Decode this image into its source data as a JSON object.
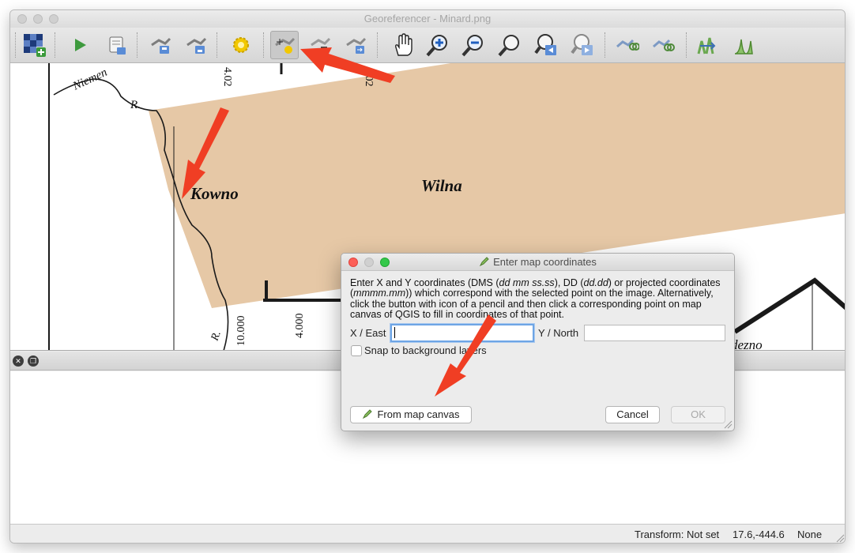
{
  "window": {
    "title": "Georeferencer - Minard.png"
  },
  "toolbar": {
    "buttons": [
      {
        "name": "open-raster",
        "icon": "add-raster-icon"
      },
      {
        "name": "start-georeferencing",
        "icon": "play-icon"
      },
      {
        "name": "generate-gdal-script",
        "icon": "script-icon"
      },
      {
        "name": "load-gcp-points",
        "icon": "load-gcp-icon"
      },
      {
        "name": "save-gcp-points",
        "icon": "save-gcp-icon"
      },
      {
        "name": "transformation-settings",
        "icon": "gear-icon"
      },
      {
        "name": "add-point",
        "icon": "add-point-icon"
      },
      {
        "name": "delete-point",
        "icon": "delete-point-icon"
      },
      {
        "name": "move-gcp-point",
        "icon": "move-point-icon"
      },
      {
        "name": "pan",
        "icon": "hand-icon"
      },
      {
        "name": "zoom-in",
        "icon": "zoom-in-icon"
      },
      {
        "name": "zoom-out",
        "icon": "zoom-out-icon"
      },
      {
        "name": "zoom-to-layer",
        "icon": "zoom-to-layer-icon"
      },
      {
        "name": "zoom-last",
        "icon": "zoom-last-icon"
      },
      {
        "name": "zoom-next",
        "icon": "zoom-next-icon"
      },
      {
        "name": "link-georeferencer-to-qgis",
        "icon": "link-georef-icon"
      },
      {
        "name": "link-qgis-to-georeferencer",
        "icon": "link-qgis-icon"
      },
      {
        "name": "full-histogram-stretch",
        "icon": "histogram-icon"
      },
      {
        "name": "local-histogram-stretch",
        "icon": "local-histogram-icon"
      }
    ]
  },
  "map": {
    "labels": {
      "niemen": "Niemen",
      "river": "R.",
      "kowno": "Kowno",
      "wilna": "Wilna",
      "lat1": "4.02",
      "lat2": "4.02",
      "num1": "10.000",
      "num2": "4.000",
      "river2": "R.",
      "edge_label": "dezno"
    },
    "colors": {
      "troop_band": "#e6c8a6",
      "ink": "#1a1a1a"
    }
  },
  "dialog": {
    "title": "Enter map coordinates",
    "description_parts": {
      "p1": "Enter X and Y coordinates (DMS (",
      "i1": "dd mm ss.ss",
      "p2": "), DD (",
      "i2": "dd.dd",
      "p3": ") or projected coordinates (",
      "i3": "mmmm.mm",
      "p4": ")) which correspond with the selected point on the image. Alternatively, click the button with icon of a pencil and then click a corresponding point on map canvas of QGIS to fill in coordinates of that point."
    },
    "x_label": "X / East",
    "x_value": "",
    "y_label": "Y / North",
    "y_value": "",
    "snap_label": "Snap to background layers",
    "snap_checked": false,
    "from_canvas_label": "From map canvas",
    "cancel_label": "Cancel",
    "ok_label": "OK"
  },
  "status": {
    "transform": "Transform: Not set",
    "coordinates": "17.6,-444.6",
    "crs": "None"
  },
  "annotations": {
    "arrow_color": "#f03e24"
  }
}
